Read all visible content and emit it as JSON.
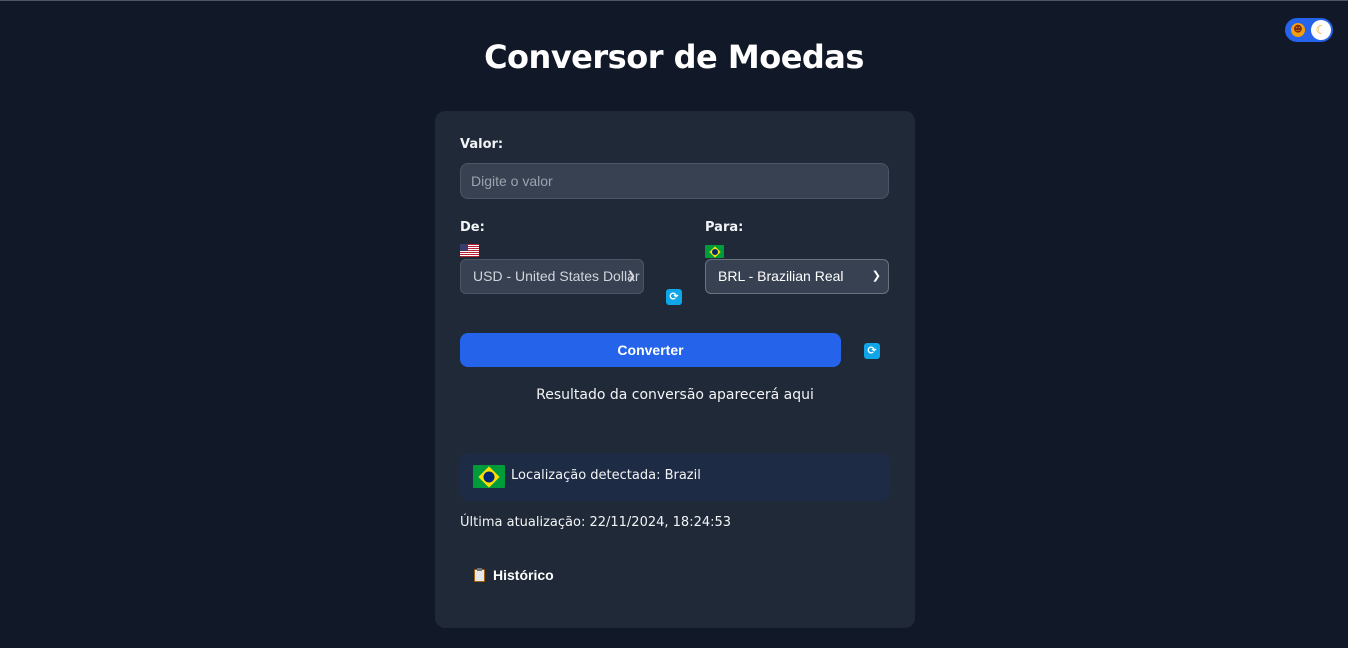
{
  "page": {
    "title": "Conversor de Moedas"
  },
  "theme_toggle": {
    "sun_icon": "sun-icon",
    "moon_icon": "moon-icon",
    "mode": "dark"
  },
  "form": {
    "value_label": "Valor:",
    "value_placeholder": "Digite o valor",
    "value": "",
    "from_label": "De:",
    "from_selected": "USD - United States Dollar",
    "from_flag": "us-flag-icon",
    "to_label": "Para:",
    "to_selected": "BRL - Brazilian Real",
    "to_flag": "br-flag-icon",
    "swap_icon": "swap-icon"
  },
  "actions": {
    "convert_label": "Converter",
    "refresh_icon": "refresh-icon"
  },
  "result": {
    "text": "Resultado da conversão aparecerá aqui"
  },
  "location": {
    "text": "Localização detectada: Brazil",
    "flag": "br-flag-icon"
  },
  "last_update": {
    "text": "Última atualização: 22/11/2024, 18:24:53"
  },
  "history": {
    "label": "Histórico",
    "icon": "clipboard-icon"
  },
  "colors": {
    "background": "#111827",
    "card": "#1f2937",
    "accent": "#2563eb",
    "icon_accent": "#0ea5e9"
  }
}
